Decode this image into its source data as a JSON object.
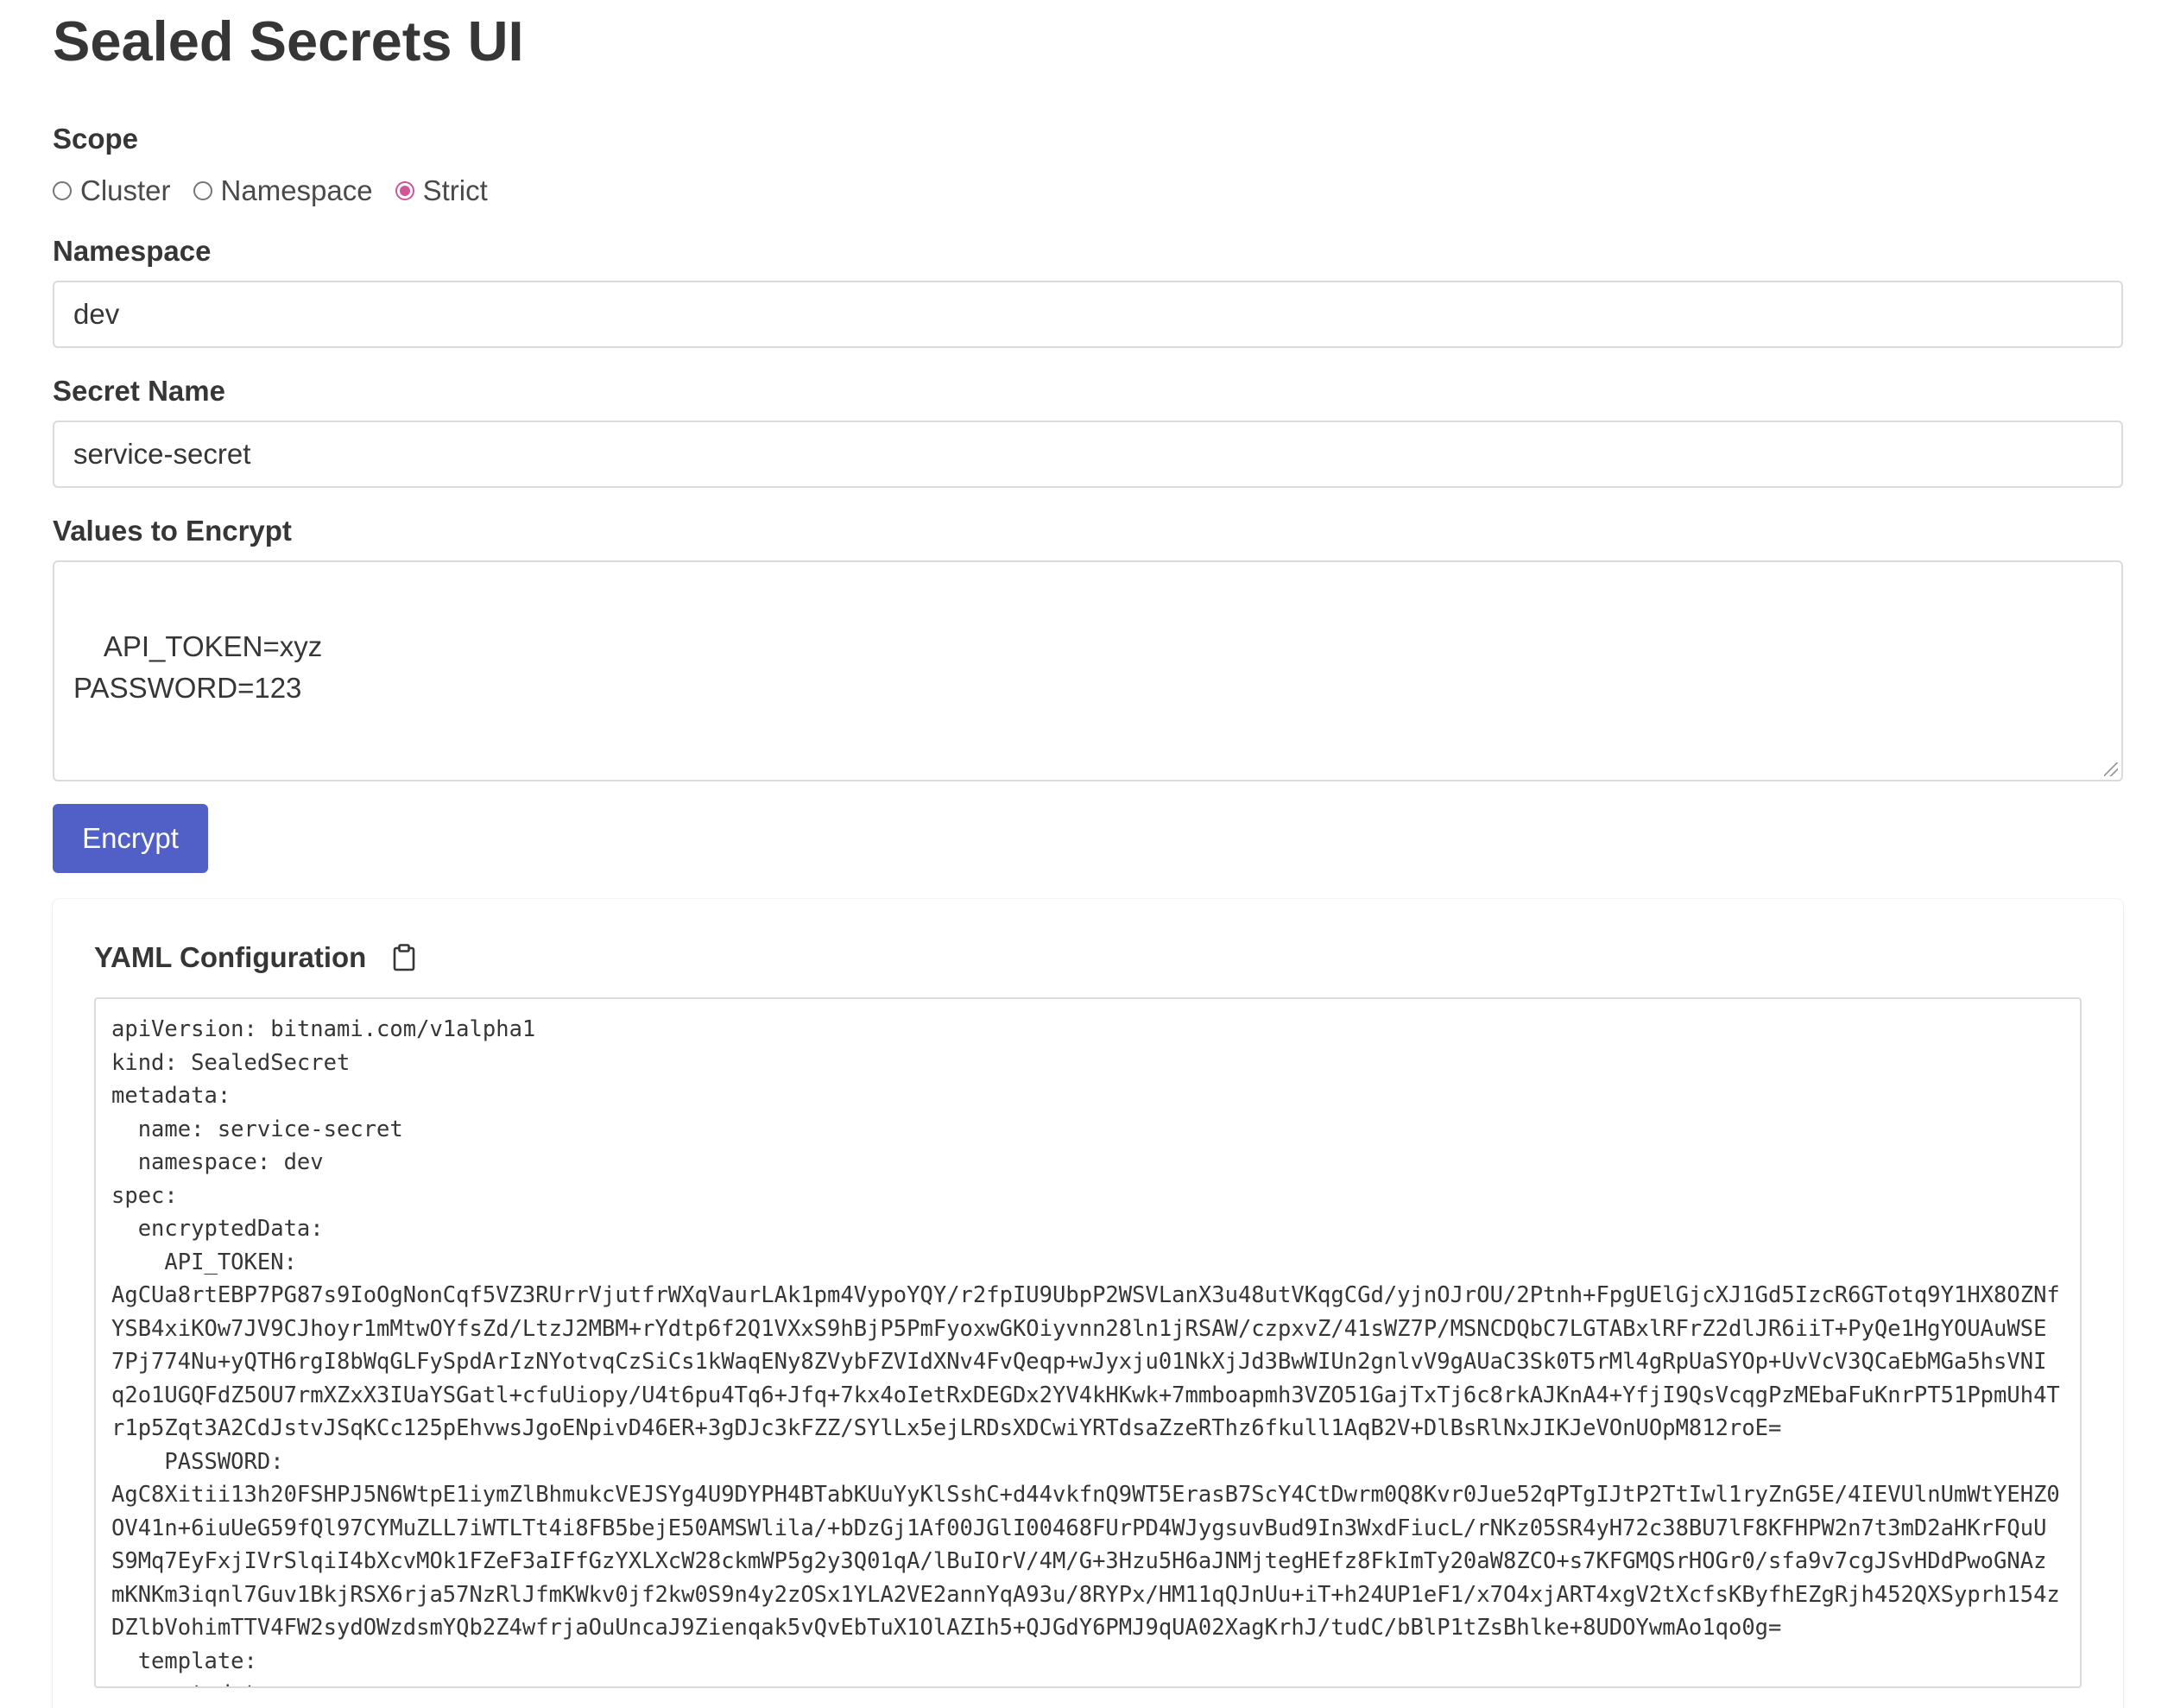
{
  "title": "Sealed Secrets UI",
  "scope": {
    "label": "Scope",
    "options": [
      "Cluster",
      "Namespace",
      "Strict"
    ],
    "selected": "Strict",
    "accent_color": "#d0569a"
  },
  "namespace": {
    "label": "Namespace",
    "value": "dev"
  },
  "secret_name": {
    "label": "Secret Name",
    "value": "service-secret"
  },
  "values": {
    "label": "Values to Encrypt",
    "value": "API_TOKEN=xyz\nPASSWORD=123"
  },
  "encrypt_button": {
    "label": "Encrypt",
    "color": "#5160c6"
  },
  "yaml": {
    "title": "YAML Configuration",
    "copy_icon": "clipboard-icon",
    "lines": [
      "apiVersion: bitnami.com/v1alpha1",
      "kind: SealedSecret",
      "metadata:",
      "  name: service-secret",
      "  namespace: dev",
      "spec:",
      "  encryptedData:",
      "    API_TOKEN:",
      "AgCUa8rtEBP7PG87s9IoOgNonCqf5VZ3RUrrVjutfrWXqVaurLAk1pm4VypoYQY/r2fpIU9UbpP2WSVLanX3u48utVKqgCGd/yjnOJrOU/2Ptnh+FpgUElGjcXJ1Gd5IzcR6GTotq9Y1HX8OZNf",
      "YSB4xiKOw7JV9CJhoyr1mMtwOYfsZd/LtzJ2MBM+rYdtp6f2Q1VXxS9hBjP5PmFyoxwGKOiyvnn28ln1jRSAW/czpxvZ/41sWZ7P/MSNCDQbC7LGTABxlRFrZ2dlJR6iiT+PyQe1HgYOUAuWSE",
      "7Pj774Nu+yQTH6rgI8bWqGLFySpdArIzNYotvqCzSiCs1kWaqENy8ZVybFZVIdXNv4FvQeqp+wJyxju01NkXjJd3BwWIUn2gnlvV9gAUaC3Sk0T5rMl4gRpUaSYOp+UvVcV3QCaEbMGa5hsVNI",
      "q2o1UGQFdZ5OU7rmXZxX3IUaYSGatl+cfuUiopy/U4t6pu4Tq6+Jfq+7kx4oIetRxDEGDx2YV4kHKwk+7mmboapmh3VZO51GajTxTj6c8rkAJKnA4+YfjI9QsVcqgPzMEbaFuKnrPT51PpmUh4T",
      "r1p5Zqt3A2CdJstvJSqKCc125pEhvwsJgoENpivD46ER+3gDJc3kFZZ/SYlLx5ejLRDsXDCwiYRTdsaZzeRThz6fkull1AqB2V+DlBsRlNxJIKJeVOnUOpM812roE=",
      "    PASSWORD:",
      "AgC8Xitii13h20FSHPJ5N6WtpE1iymZlBhmukcVEJSYg4U9DYPH4BTabKUuYyKlSshC+d44vkfnQ9WT5ErasB7ScY4CtDwrm0Q8Kvr0Jue52qPTgIJtP2TtIwl1ryZnG5E/4IEVUlnUmWtYEHZ0",
      "OV41n+6iuUeG59fQl97CYMuZLL7iWTLTt4i8FB5bejE50AMSWlila/+bDzGj1Af00JGlI00468FUrPD4WJygsuvBud9In3WxdFiucL/rNKz05SR4yH72c38BU7lF8KFHPW2n7t3mD2aHKrFQuU",
      "S9Mq7EyFxjIVrSlqiI4bXcvMOk1FZeF3aIFfGzYXLXcW28ckmWP5g2y3Q01qA/lBuIOrV/4M/G+3Hzu5H6aJNMjtegHEfz8FkImTy20aW8ZCO+s7KFGMQSrHOGr0/sfa9v7cgJSvHDdPwoGNAz",
      "mKNKm3iqnl7Guv1BkjRSX6rja57NzRlJfmKWkv0jf2kw0S9n4y2zOSx1YLA2VE2annYqA93u/8RYPx/HM11qQJnUu+iT+h24UP1eF1/x7O4xjART4xgV2tXcfsKByfhEZgRjh452QXSyprh154z",
      "DZlbVohimTTV4FW2sydOWzdsmYQb2Z4wfrjaOuUncaJ9Zienqak5vQvEbTuX1OlAZIh5+QJGdY6PMJ9qUA02XagKrhJ/tudC/bBlP1tZsBhlke+8UDOYwmAo1qo0g=",
      "  template:",
      "    metadata:"
    ]
  }
}
